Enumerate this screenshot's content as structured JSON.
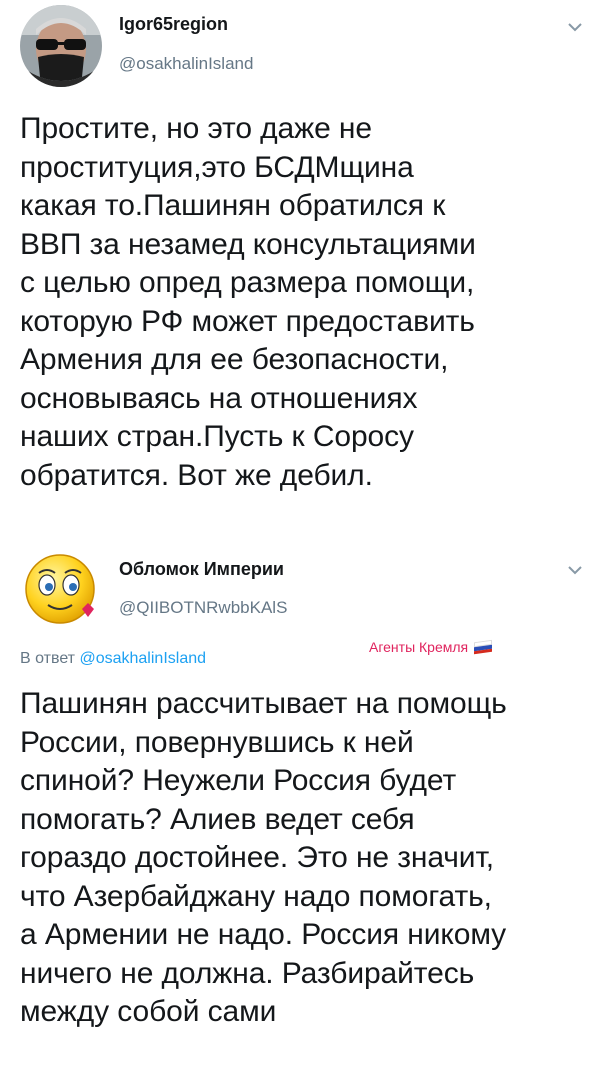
{
  "tweet1": {
    "author_name": "Igor65region",
    "author_handle": "@osakhalinIsland",
    "lines": [
      "Простите, но это даже не",
      "проституция,это БСДМщина",
      "какая то.Пашинян обратился к",
      "ВВП за незамед консультациями",
      "с целью опред  размера помощи,",
      "которую РФ может предоставить",
      "Армения для  ее безопасности,",
      "основываясь на отношениях",
      "наших стран.Пусть к Соросу",
      "обратится. Вот же дебил."
    ]
  },
  "tweet2": {
    "author_name": "Обломок Империи",
    "author_handle": "@QIIBOTNRwbbKAlS",
    "reply_prefix": "В ответ",
    "reply_to": "@osakhalinIsland",
    "badge_text": "Агенты Кремля",
    "lines": [
      "Пашинян рассчитывает на помощь",
      "России, повернувшись к ней",
      "спиной? Неужели Россия будет",
      "помогать? Алиев ведет себя",
      "гораздо достойнее. Это не значит,",
      "что Азербайджану надо помогать,",
      "а Армении не надо. Россия никому",
      "ничего не должна. Разбирайтесь",
      "между собой сами"
    ]
  },
  "colors": {
    "text": "#14171a",
    "secondary": "#657786",
    "link": "#1da1f2",
    "badge": "#e0245e"
  },
  "icons": {
    "menu": "chevron-down-icon",
    "avatar1": "man-sunglasses-mask-avatar",
    "avatar2": "smiley-emoji-avatar",
    "flag": "russian-flag-icon"
  }
}
